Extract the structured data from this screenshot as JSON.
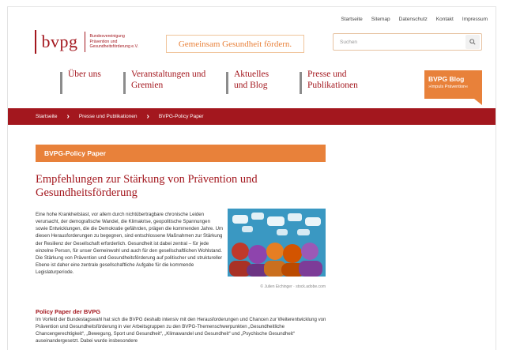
{
  "toplinks": [
    "Startseite",
    "Sitemap",
    "Datenschutz",
    "Kontakt",
    "Impressum"
  ],
  "logo": {
    "text": "bvpg",
    "sub_lines": [
      "Bundesvereinigung",
      "Prävention und",
      "Gesundheitsförderung e.V."
    ]
  },
  "slogan": "Gemeinsam Gesundheit fördern.",
  "search": {
    "placeholder": "Suchen",
    "icon": "search-icon"
  },
  "nav": [
    {
      "label": "Über uns"
    },
    {
      "label": "Veranstaltungen und Gremien"
    },
    {
      "label": "Aktuelles und Blog"
    },
    {
      "label": "Presse und Publikationen"
    }
  ],
  "blog_button": {
    "title": "BVPG Blog",
    "subtitle": "»Impuls Prävention«"
  },
  "breadcrumb": [
    "Startseite",
    "Presse und Publikationen",
    "BVPG-Policy Paper"
  ],
  "section_title": "BVPG-Policy Paper",
  "headline": "Empfehlungen zur Stärkung von Prävention und Gesundheitsförderung",
  "intro": "Eine hohe Krankheitslast, vor allem durch nichtübertragbare chronische Leiden verursacht, der demografische Wandel, die Klimakrise, geopolitische Spannungen sowie Entwicklungen, die die Demokratie gefährden, prägen die kommenden Jahre. Um diesen Herausforderungen zu begegnen, sind entschlossene Maßnahmen zur Stärkung der Resilienz der Gesellschaft erforderlich. Gesundheit ist dabei zentral – für jede einzelne Person, für unser Gemeinwohl und auch für den gesellschaftlichen Wohlstand. Die Stärkung von Prävention und Gesundheitsförderung auf politischer und struktureller Ebene ist daher eine zentrale gesellschaftliche Aufgabe für die kommende Legislaturperiode.",
  "image_caption": "© Julien Eichinger · stock.adobe.com",
  "subheading": "Policy Paper der BVPG",
  "body": "Im Vorfeld der Bundestagswahl hat sich die BVPG deshalb intensiv mit den Herausforderungen und Chancen zur Weiterentwicklung von Prävention und Gesundheitsförderung in vier Arbeitsgruppen zu den BVPG-Themenschwerpunkten „Gesundheitliche Chancengerechtigkeit“, „Bewegung, Sport und Gesundheit“, „Klimawandel und Gesundheit“ und „Psychische Gesundheit“ auseinandergesetzt. Dabei wurde insbesondere",
  "colors": {
    "brand_red": "#a3171e",
    "accent_orange": "#e8813a",
    "nav_bar_grey": "#8c8c8c"
  }
}
